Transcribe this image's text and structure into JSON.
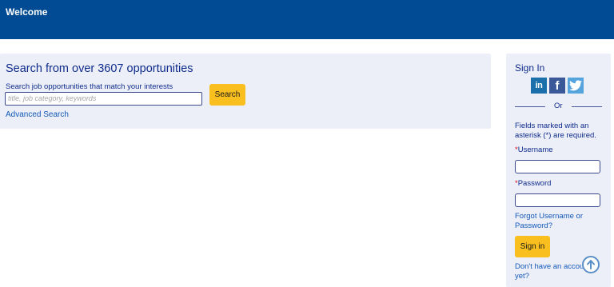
{
  "header": {
    "title": "Welcome"
  },
  "search": {
    "heading": "Search from over 3607 opportunities",
    "label": "Search job opportunities that match your interests",
    "placeholder": "title, job category, keywords",
    "button": "Search",
    "advanced_link": "Advanced Search"
  },
  "signin": {
    "title": "Sign In",
    "social": [
      {
        "name": "linkedin-icon",
        "glyph": "in"
      },
      {
        "name": "facebook-icon",
        "glyph": "f"
      },
      {
        "name": "twitter-icon",
        "glyph": "t"
      }
    ],
    "or_text": "Or",
    "required_note": "Fields marked with an asterisk (*) are required.",
    "username_label": "Username",
    "password_label": "Password",
    "asterisk": "*",
    "forgot_link": "Forgot Username or Password?",
    "button": "Sign in",
    "no_account_link": "Don't have an account yet?"
  },
  "colors": {
    "header_bg": "#004b93",
    "panel_bg": "#eceff8",
    "button_bg": "#f9bf1e",
    "link": "#1458b7",
    "text": "#0f2c8c",
    "required": "#d3111c"
  }
}
